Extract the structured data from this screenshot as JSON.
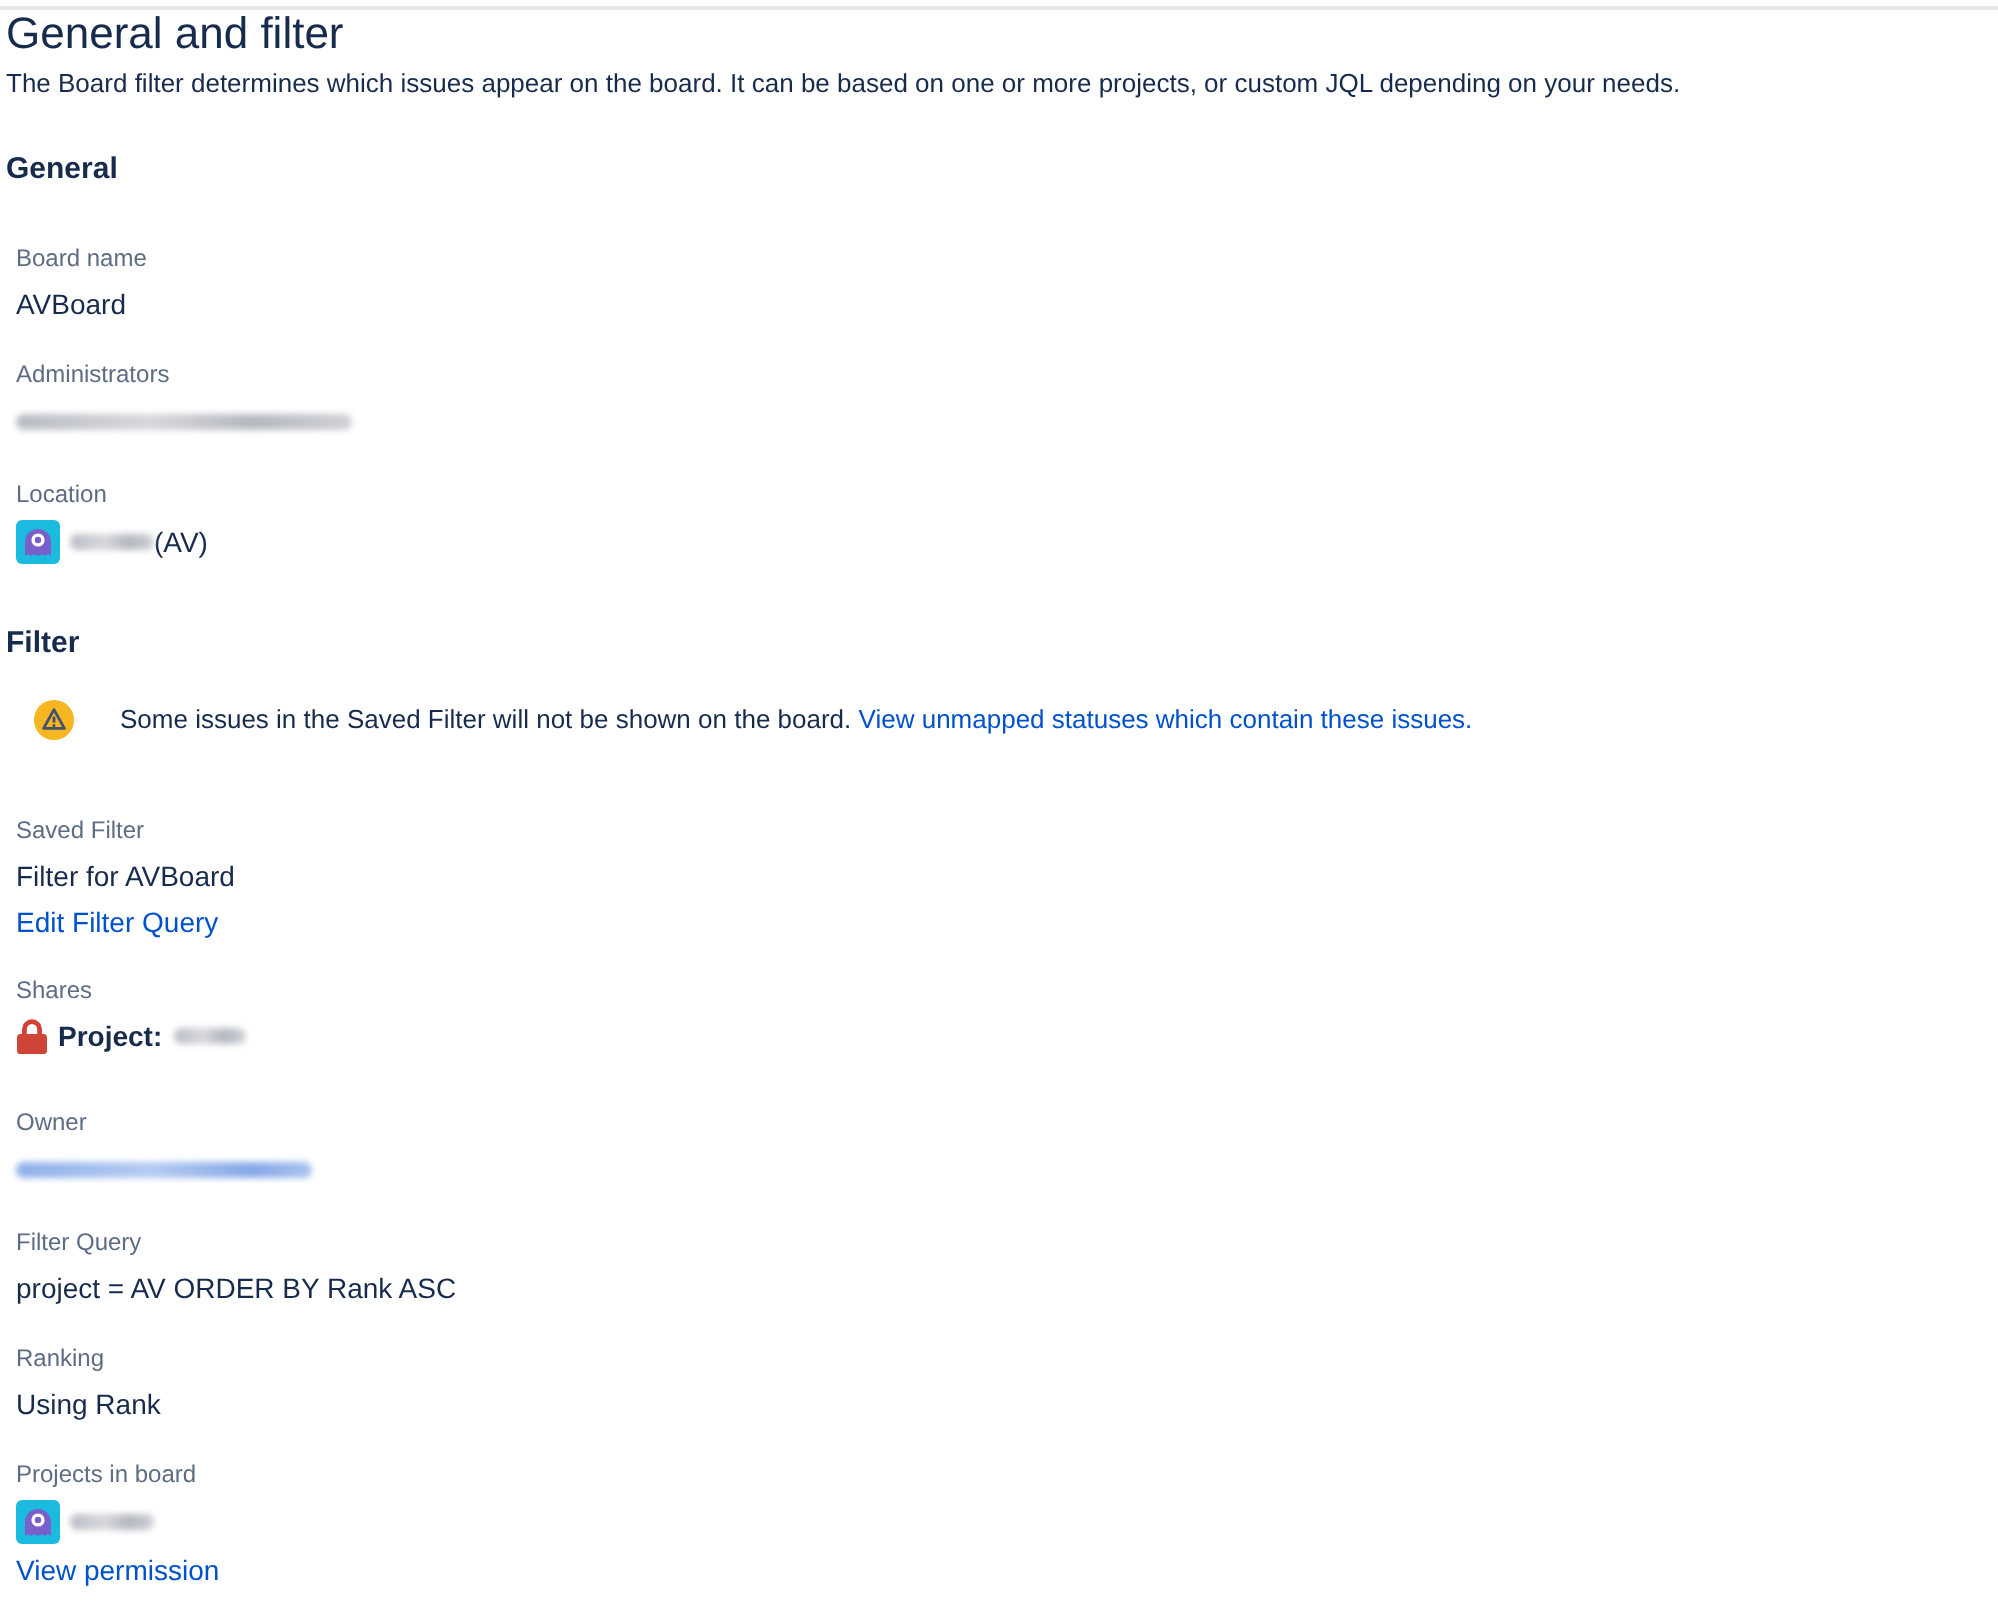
{
  "page": {
    "title": "General and filter",
    "description": "The Board filter determines which issues appear on the board. It can be based on one or more projects, or custom JQL depending on your needs."
  },
  "sections": [
    {
      "heading": "General",
      "fields": [
        {
          "label": "Board name",
          "kind": "text",
          "value": "AVBoard"
        },
        {
          "label": "Administrators",
          "kind": "redacted"
        },
        {
          "label": "Location",
          "kind": "project",
          "value": "(AV)"
        }
      ]
    },
    {
      "heading": "Filter",
      "warning": {
        "text": "Some issues in the Saved Filter will not be shown on the board.",
        "link": "View unmapped statuses which contain these issues."
      },
      "fields": [
        {
          "label": "Saved Filter",
          "kind": "text",
          "value": "Filter for AVBoard",
          "link": "Edit Filter Query"
        },
        {
          "label": "Shares",
          "kind": "share",
          "value": "Project:"
        },
        {
          "label": "Owner",
          "kind": "redactedlink"
        },
        {
          "label": "Filter Query",
          "kind": "text",
          "value": "project = AV ORDER BY Rank ASC"
        },
        {
          "label": "Ranking",
          "kind": "text",
          "value": "Using Rank"
        },
        {
          "label": "Projects in board",
          "kind": "project",
          "link": "View permission"
        }
      ]
    }
  ]
}
